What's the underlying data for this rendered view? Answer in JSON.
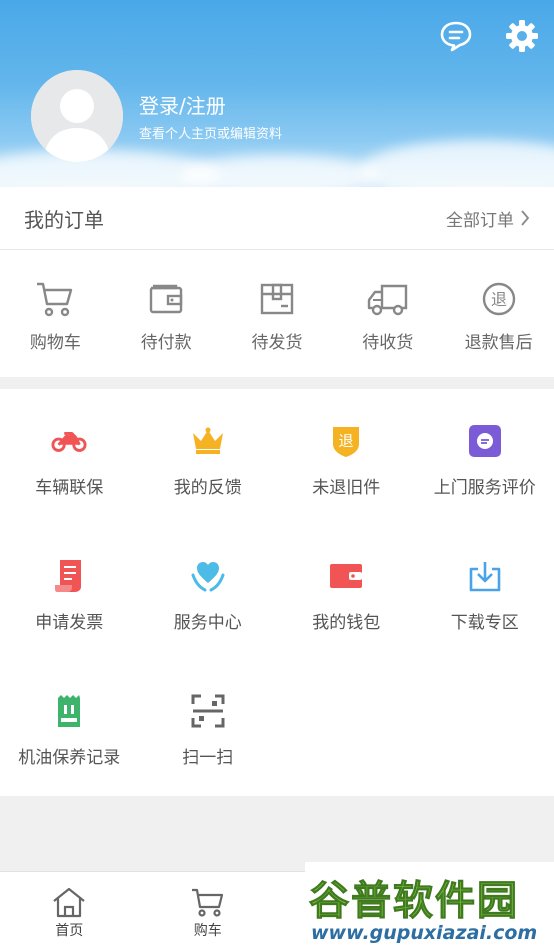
{
  "header": {
    "login_title": "登录/注册",
    "login_subtitle": "查看个人主页或编辑资料",
    "icons": [
      "message-icon",
      "settings-gear-icon"
    ]
  },
  "orders": {
    "title": "我的订单",
    "all_label": "全部订单",
    "items": [
      {
        "label": "购物车",
        "icon": "cart-icon"
      },
      {
        "label": "待付款",
        "icon": "wallet-icon"
      },
      {
        "label": "待发货",
        "icon": "package-icon"
      },
      {
        "label": "待收货",
        "icon": "truck-icon"
      },
      {
        "label": "退款售后",
        "icon": "refund-icon"
      }
    ]
  },
  "services": {
    "items": [
      {
        "label": "车辆联保",
        "icon": "motorcycle-icon",
        "color": "#f05454"
      },
      {
        "label": "我的反馈",
        "icon": "crown-icon",
        "color": "#f5b324"
      },
      {
        "label": "未退旧件",
        "icon": "return-shield-icon",
        "color": "#f5b324"
      },
      {
        "label": "上门服务评价",
        "icon": "chat-square-icon",
        "color": "#7b5cd6"
      },
      {
        "label": "申请发票",
        "icon": "invoice-icon",
        "color": "#f05454"
      },
      {
        "label": "服务中心",
        "icon": "heart-hands-icon",
        "color": "#4cbbe8"
      },
      {
        "label": "我的钱包",
        "icon": "wallet-red-icon",
        "color": "#f05454"
      },
      {
        "label": "下载专区",
        "icon": "download-icon",
        "color": "#4aa3e8"
      },
      {
        "label": "机油保养记录",
        "icon": "oil-record-icon",
        "color": "#3db36b"
      },
      {
        "label": "扫一扫",
        "icon": "scan-icon",
        "color": "#666666"
      }
    ]
  },
  "tabbar": {
    "items": [
      {
        "label": "首页",
        "icon": "home-icon"
      },
      {
        "label": "购车",
        "icon": "cart-icon"
      }
    ]
  },
  "watermark": {
    "logo": "谷普软件园",
    "url": "www.gupuxiazai.com"
  }
}
